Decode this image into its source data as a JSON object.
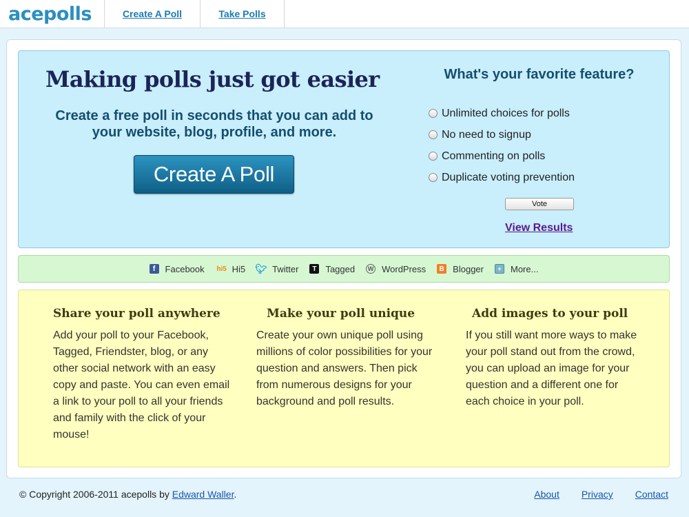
{
  "header": {
    "logo": "acepolls",
    "nav": {
      "create": "Create A Poll",
      "take": "Take Polls"
    }
  },
  "hero": {
    "title": "Making polls just got easier",
    "subtitle": "Create a free poll in seconds that you can add to your website, blog, profile, and more.",
    "cta": "Create A Poll"
  },
  "poll": {
    "question": "What's your favorite feature?",
    "options": [
      "Unlimited choices for polls",
      "No need to signup",
      "Commenting on polls",
      "Duplicate voting prevention"
    ],
    "vote_label": "Vote",
    "results_label": "View Results"
  },
  "share": {
    "items": [
      {
        "label": "Facebook",
        "icon": "facebook-icon"
      },
      {
        "label": "Hi5",
        "icon": "hi5-icon"
      },
      {
        "label": "Twitter",
        "icon": "twitter-icon"
      },
      {
        "label": "Tagged",
        "icon": "tagged-icon"
      },
      {
        "label": "WordPress",
        "icon": "wordpress-icon"
      },
      {
        "label": "Blogger",
        "icon": "blogger-icon"
      },
      {
        "label": "More...",
        "icon": "more-icon"
      }
    ]
  },
  "features": [
    {
      "title": "Share your poll anywhere",
      "text": "Add your poll to your Facebook, Tagged, Friendster, blog, or any other social network with an easy copy and paste. You can even email a link to your poll to all your friends and family with the click of your mouse!"
    },
    {
      "title": "Make your poll unique",
      "text": "Create your own unique poll using millions of color possibilities for your question and answers. Then pick from numerous designs for your background and poll results."
    },
    {
      "title": "Add images to your poll",
      "text": "If you still want more ways to make your poll stand out from the crowd, you can upload an image for your question and a different one for each choice in your poll."
    }
  ],
  "footer": {
    "copyright": "© Copyright 2006-2011 acepolls by",
    "author": "Edward Waller",
    "period": ".",
    "links": {
      "about": "About",
      "privacy": "Privacy",
      "contact": "Contact"
    }
  },
  "colors": {
    "brand": "#2a8fc0",
    "hero_bg": "#c9eefc",
    "share_bg": "#d6f7d2",
    "features_bg": "#ffffbf",
    "page_bg": "#e3f4fc"
  }
}
